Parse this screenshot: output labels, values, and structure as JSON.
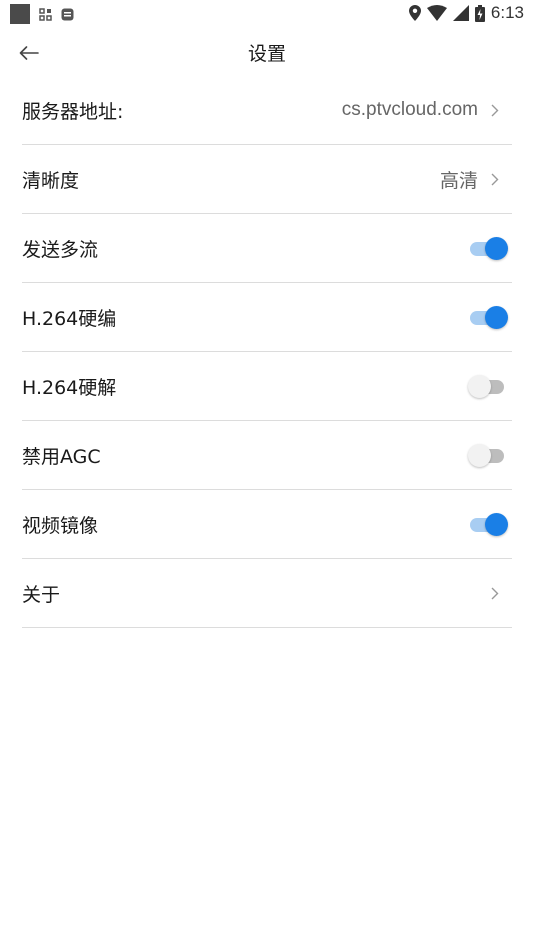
{
  "status_bar": {
    "time": "6:13",
    "icons": [
      "notification-square-icon",
      "app-grid-icon",
      "message-icon",
      "location-icon",
      "wifi-icon",
      "cell-signal-icon",
      "battery-icon"
    ]
  },
  "header": {
    "back_icon": "arrow-left-icon",
    "title": "设置"
  },
  "settings": {
    "server": {
      "label": "服务器地址:",
      "value": "cs.ptvcloud.com"
    },
    "clarity": {
      "label": "清晰度",
      "value": "高清"
    },
    "multi_stream": {
      "label": "发送多流",
      "enabled": true
    },
    "h264_hw_encode": {
      "label": "H.264硬编",
      "enabled": true
    },
    "h264_hw_decode": {
      "label": "H.264硬解",
      "enabled": false
    },
    "disable_agc": {
      "label": "禁用AGC",
      "enabled": false
    },
    "video_mirror": {
      "label": "视频镜像",
      "enabled": true
    },
    "about": {
      "label": "关于"
    }
  },
  "colors": {
    "accent": "#1a7fe6",
    "accent_track": "#a8cdf2",
    "toggle_off_thumb": "#f2f2f2",
    "toggle_off_track": "#bdbdbd",
    "divider": "#dcdcdc"
  }
}
